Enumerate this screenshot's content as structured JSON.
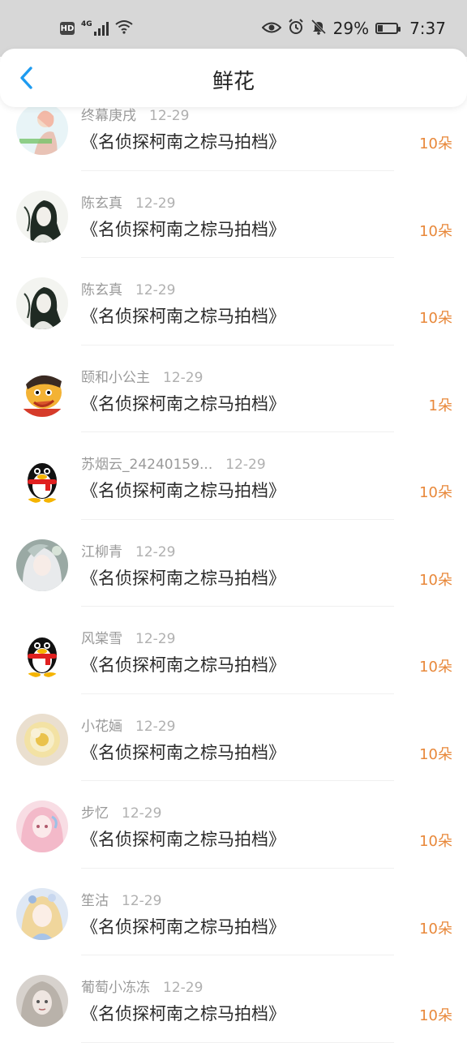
{
  "status_bar": {
    "hd": "HD",
    "network": "4G",
    "battery": "29%",
    "time": "7:37",
    "battery_level": 0.29
  },
  "header": {
    "title": "鲜花",
    "back_icon": "chevron-left-icon"
  },
  "colors": {
    "accent": "#e8883a",
    "back": "#1e9bf0"
  },
  "items": [
    {
      "name": "终幕庚戌",
      "date": "12-29",
      "work": "《名侦探柯南之棕马拍档》",
      "amount": "10朵",
      "avatar": "girl-with-caption"
    },
    {
      "name": "陈玄真",
      "date": "12-29",
      "work": "《名侦探柯南之棕马拍档》",
      "amount": "10朵",
      "avatar": "ink-portrait"
    },
    {
      "name": "陈玄真",
      "date": "12-29",
      "work": "《名侦探柯南之棕马拍档》",
      "amount": "10朵",
      "avatar": "ink-portrait"
    },
    {
      "name": "颐和小公主",
      "date": "12-29",
      "work": "《名侦探柯南之棕马拍档》",
      "amount": "1朵",
      "avatar": "cartoon-boy"
    },
    {
      "name": "苏烟云_24240159...",
      "date": "12-29",
      "work": "《名侦探柯南之棕马拍档》",
      "amount": "10朵",
      "avatar": "qq-penguin"
    },
    {
      "name": "江柳青",
      "date": "12-29",
      "work": "《名侦探柯南之棕马拍档》",
      "amount": "10朵",
      "avatar": "white-hair-girl"
    },
    {
      "name": "风棠雪",
      "date": "12-29",
      "work": "《名侦探柯南之棕马拍档》",
      "amount": "10朵",
      "avatar": "qq-penguin"
    },
    {
      "name": "小花婳",
      "date": "12-29",
      "work": "《名侦探柯南之棕马拍档》",
      "amount": "10朵",
      "avatar": "flower"
    },
    {
      "name": "步忆",
      "date": "12-29",
      "work": "《名侦探柯南之棕马拍档》",
      "amount": "10朵",
      "avatar": "pink-hair-girl"
    },
    {
      "name": "笙沽",
      "date": "12-29",
      "work": "《名侦探柯南之棕马拍档》",
      "amount": "10朵",
      "avatar": "golden-hair-girl"
    },
    {
      "name": "葡萄小冻冻",
      "date": "12-29",
      "work": "《名侦探柯南之棕马拍档》",
      "amount": "10朵",
      "avatar": "grey-hair-girl"
    }
  ]
}
